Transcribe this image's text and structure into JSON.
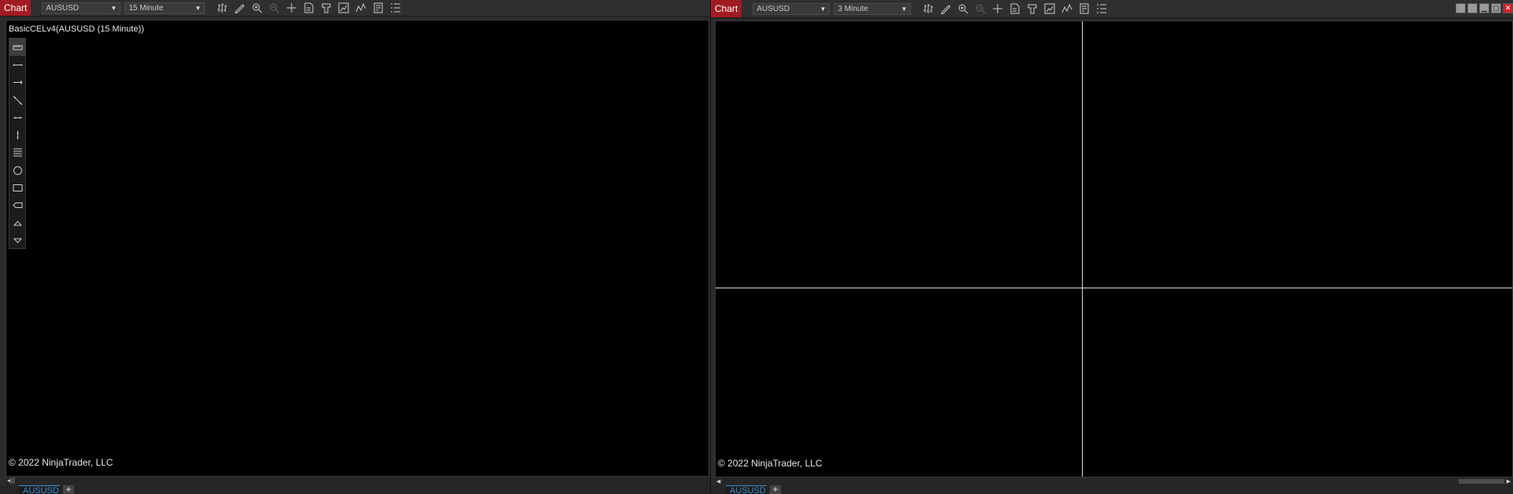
{
  "left_chart": {
    "title": "Chart",
    "instrument": "AUSUSD",
    "period": "15 Minute",
    "indicator_label": "BasicCELv4(AUSUSD (15 Minute))",
    "copyright": "© 2022 NinjaTrader, LLC",
    "tab_label": "AUSUSD",
    "tab_add": "+",
    "toolbar_icons": [
      "bar-type-icon",
      "pencil-draw-icon",
      "zoom-in-icon",
      "zoom-out-icon",
      "crosshair-icon",
      "properties-icon",
      "templates-icon",
      "strategies-icon",
      "indicators-icon",
      "data-box-icon",
      "list-icon"
    ],
    "drawing_tools": [
      "ruler-icon",
      "line-icon",
      "ray-icon",
      "extended-line-icon",
      "arrow-line-icon",
      "vertical-line-icon",
      "horizontal-lines-icon",
      "ellipse-icon",
      "rectangle-icon",
      "text-arrow-icon",
      "triangle-up-icon",
      "triangle-down-icon"
    ]
  },
  "right_chart": {
    "title": "Chart",
    "instrument": "AUSUSD",
    "period": "3 Minute",
    "copyright": "© 2022 NinjaTrader, LLC",
    "tab_label": "AUSUSD",
    "tab_add": "+",
    "window_controls": [
      "tile-icon",
      "tile-alt-icon",
      "minimize-icon",
      "maximize-icon",
      "close-icon"
    ]
  },
  "colors": {
    "chart_tag": "#a11b22",
    "tab_accent": "#3e8ed0",
    "plot_bg": "#000000",
    "crosshair": "#d8d8d8"
  }
}
